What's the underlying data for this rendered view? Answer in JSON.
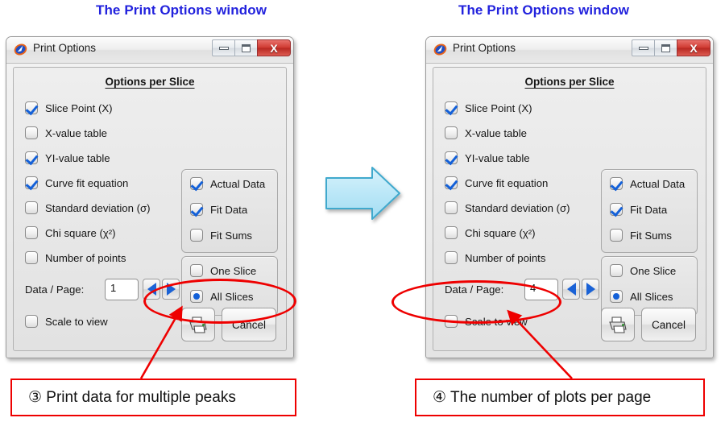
{
  "panels": [
    {
      "caption": "The Print Options window",
      "window": {
        "title": "Print Options",
        "icon": "app-logo-icon",
        "buttons": {
          "minimize": "minimize-icon",
          "maximize": "maximize-icon",
          "close": "X"
        },
        "section_title": "Options per Slice",
        "slice_options": [
          {
            "label": "Slice Point (X)",
            "checked": true
          },
          {
            "label": "X-value table",
            "checked": false
          },
          {
            "label": "YI-value table",
            "checked": true
          },
          {
            "label": "Curve fit equation",
            "checked": true
          },
          {
            "label": "Standard deviation (σ)",
            "checked": false
          },
          {
            "label": "Chi square (χ²)",
            "checked": false
          },
          {
            "label": "Number of points",
            "checked": false
          }
        ],
        "data_options": [
          {
            "label": "Actual Data",
            "checked": true
          },
          {
            "label": "Fit Data",
            "checked": true
          },
          {
            "label": "Fit Sums",
            "checked": false
          }
        ],
        "slice_scope": [
          {
            "label": "One Slice",
            "selected": false
          },
          {
            "label": "All Slices",
            "selected": true
          }
        ],
        "data_per_page_label": "Data / Page:",
        "data_per_page_value": "1",
        "spin_down_icon": "triangle-left-icon",
        "spin_up_icon": "triangle-right-icon",
        "scale_to_view": {
          "label": "Scale to view",
          "checked": false
        },
        "print_button_icon": "printer-icon",
        "cancel_label": "Cancel"
      },
      "annotation": {
        "number": "③",
        "text": "Print data for multiple peaks",
        "full_text": "③ Print data for multiple peaks"
      }
    },
    {
      "caption": "The Print Options window",
      "window": {
        "title": "Print Options",
        "icon": "app-logo-icon",
        "buttons": {
          "minimize": "minimize-icon",
          "maximize": "maximize-icon",
          "close": "X"
        },
        "section_title": "Options per Slice",
        "slice_options": [
          {
            "label": "Slice Point (X)",
            "checked": true
          },
          {
            "label": "X-value table",
            "checked": false
          },
          {
            "label": "YI-value table",
            "checked": true
          },
          {
            "label": "Curve fit equation",
            "checked": true
          },
          {
            "label": "Standard deviation (σ)",
            "checked": false
          },
          {
            "label": "Chi square (χ²)",
            "checked": false
          },
          {
            "label": "Number of points",
            "checked": false
          }
        ],
        "data_options": [
          {
            "label": "Actual Data",
            "checked": true
          },
          {
            "label": "Fit Data",
            "checked": true
          },
          {
            "label": "Fit Sums",
            "checked": false
          }
        ],
        "slice_scope": [
          {
            "label": "One Slice",
            "selected": false
          },
          {
            "label": "All Slices",
            "selected": true
          }
        ],
        "data_per_page_label": "Data / Page:",
        "data_per_page_value": "4",
        "spin_down_icon": "triangle-left-icon",
        "spin_up_icon": "triangle-right-icon",
        "scale_to_view": {
          "label": "Scale to view",
          "checked": false
        },
        "print_button_icon": "printer-icon",
        "cancel_label": "Cancel"
      },
      "annotation": {
        "number": "④",
        "text": "The number of plots per page",
        "full_text": "④ The number of plots per page"
      }
    }
  ],
  "flow_arrow": {
    "icon": "right-arrow-icon",
    "fill": "#bfe9f8",
    "stroke": "#3aa8cc"
  },
  "colors": {
    "caption": "#2222dd",
    "annotation": "#ee0000",
    "check": "#1360d8",
    "close_button": "#cf3a32"
  }
}
